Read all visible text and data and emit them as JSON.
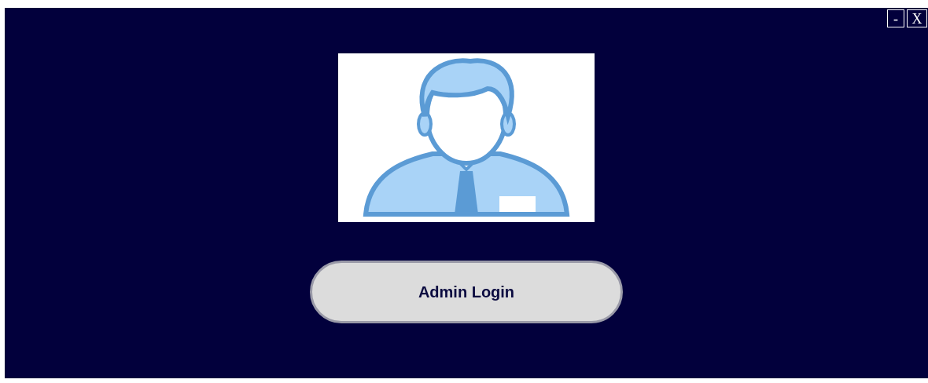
{
  "window_controls": [
    {
      "label": "-",
      "kind": "minimize"
    },
    {
      "label": "X",
      "kind": "close"
    }
  ],
  "login_button": {
    "label": "Admin Login"
  }
}
